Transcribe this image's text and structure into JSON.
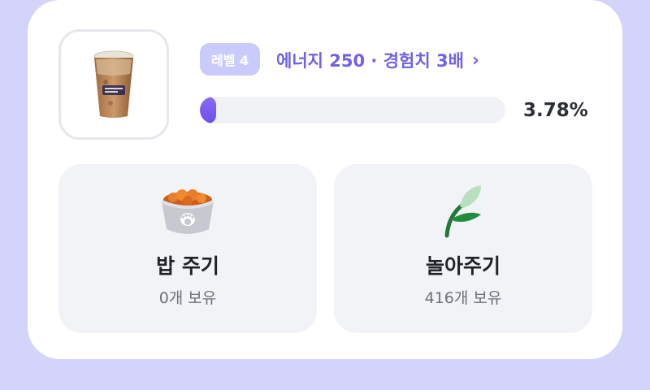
{
  "pet": {
    "image_alt": "iced coffee cup",
    "level_badge": "레벨 4",
    "reward_text": "에너지 250 · 경험치 3배",
    "chevron": "›",
    "progress_percent": 3.78,
    "progress_text": "3.78%"
  },
  "actions": [
    {
      "id": "feed",
      "title": "밥 주기",
      "count_text": "0개 보유",
      "icon": "food-bowl-icon"
    },
    {
      "id": "play",
      "title": "놀아주기",
      "count_text": "416개 보유",
      "icon": "sprout-icon"
    }
  ],
  "colors": {
    "background": "#d4d4fb",
    "accent": "#6f62e8",
    "badge": "#c9cbfa",
    "progress": "#7a5cf0",
    "tile": "#f2f3f6"
  }
}
